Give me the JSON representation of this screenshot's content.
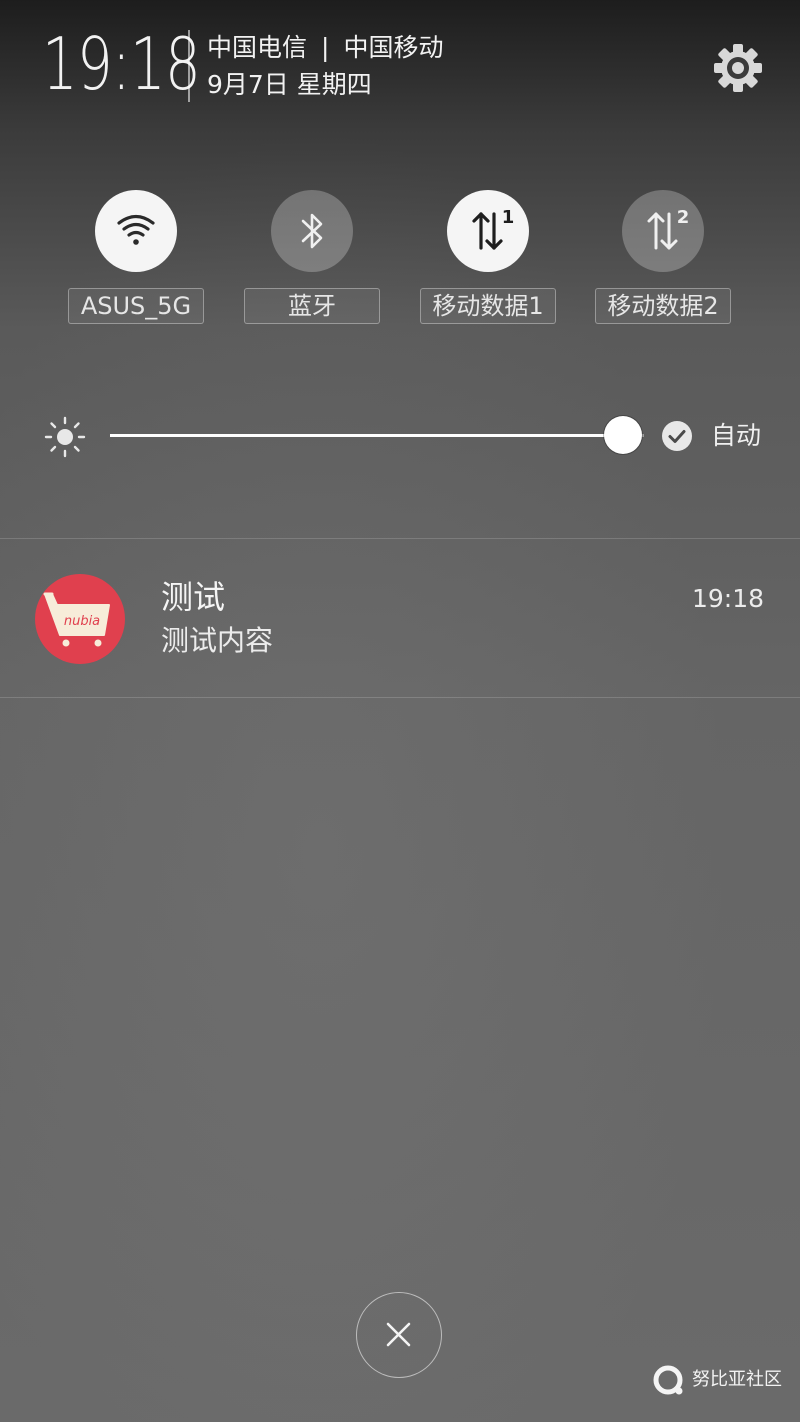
{
  "status": {
    "time": "19:18",
    "carrier_1": "中国电信",
    "carrier_separator": "|",
    "carrier_2": "中国移动",
    "date": "9月7日 星期四"
  },
  "toggles": [
    {
      "label": "ASUS_5G",
      "icon": "wifi-icon",
      "active": true
    },
    {
      "label": "蓝牙",
      "icon": "bluetooth-icon",
      "active": false
    },
    {
      "label": "移动数据1",
      "icon": "mobile-data-1-icon",
      "active": true
    },
    {
      "label": "移动数据2",
      "icon": "mobile-data-2-icon",
      "active": false
    }
  ],
  "brightness": {
    "level": 0.96,
    "auto_label": "自动",
    "auto_checked": true
  },
  "notification": {
    "app_icon": "nubia-shop-icon",
    "app_icon_text": "nubia",
    "title": "测试",
    "body": "测试内容",
    "time": "19:18"
  },
  "watermark": {
    "text": "努比亚社区"
  },
  "colors": {
    "notification_icon_bg": "#e0404e",
    "toggle_on": "#f5f5f5",
    "toggle_off": "rgba(255,255,255,0.25)"
  }
}
